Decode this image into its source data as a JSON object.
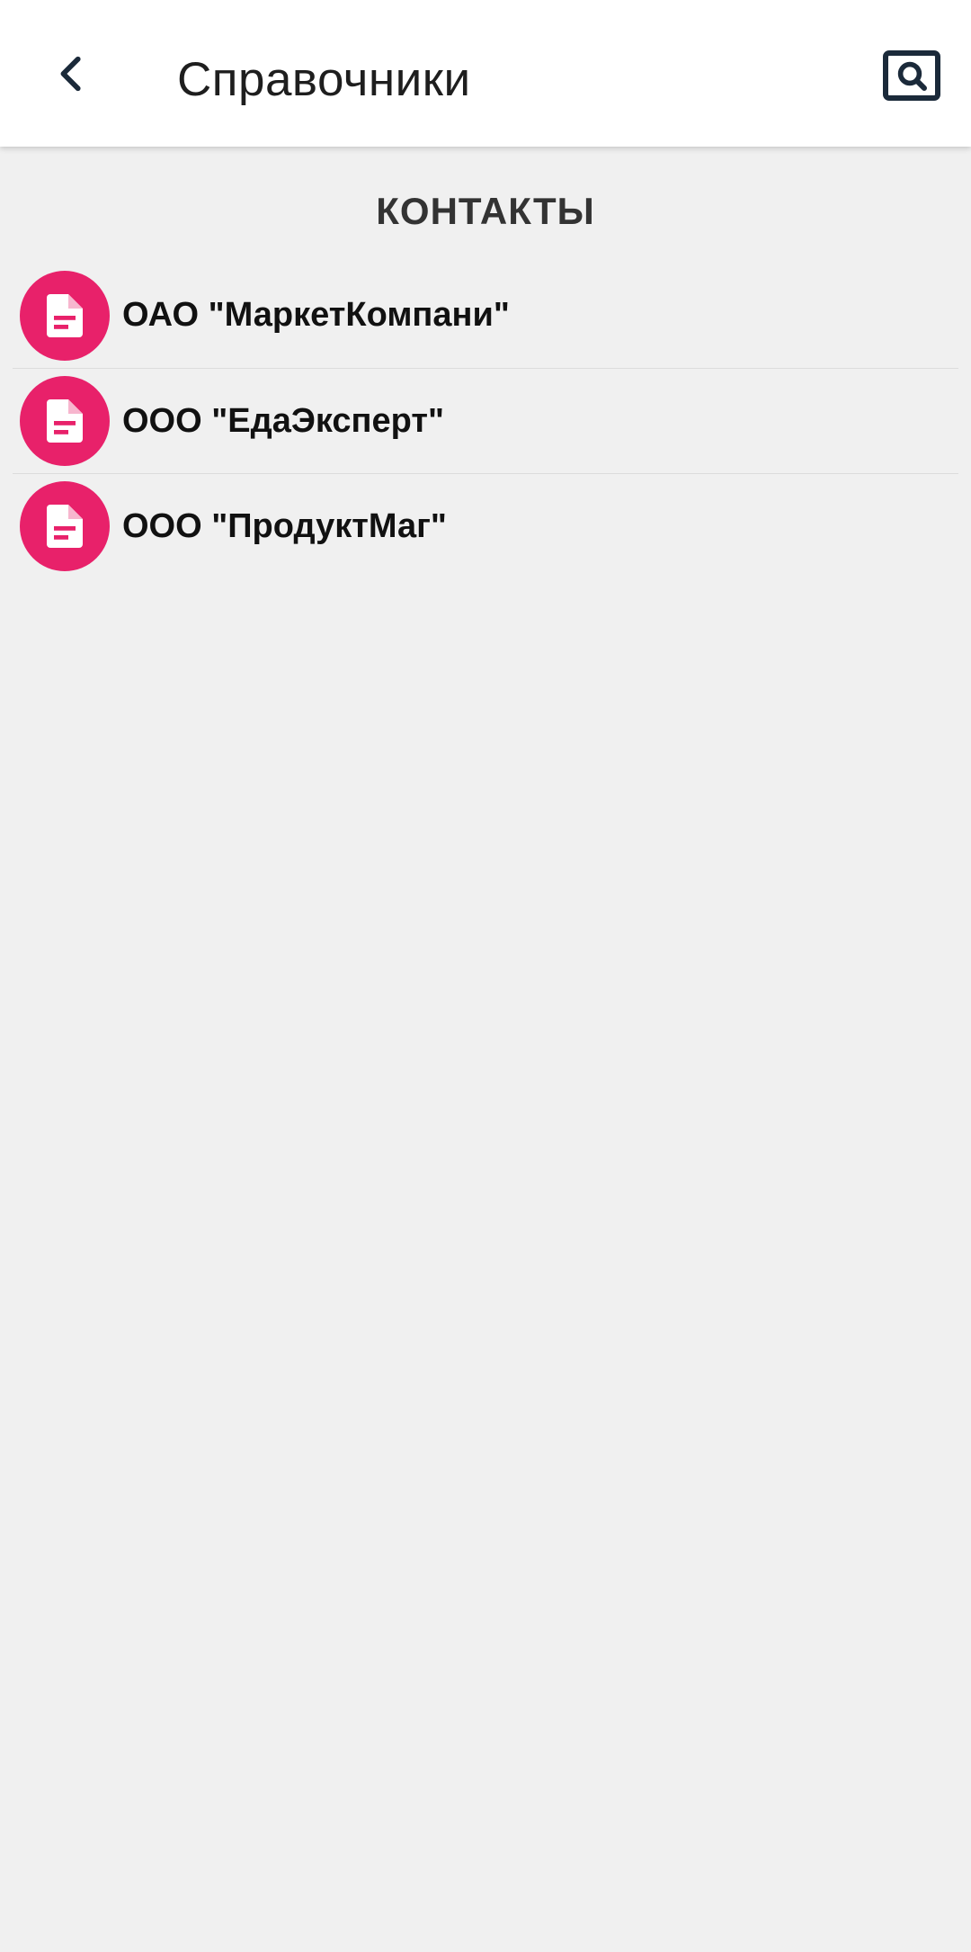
{
  "app_bar": {
    "title": "Справочники",
    "back_icon": "chevron-left-icon",
    "search_icon": "search-document-icon"
  },
  "section": {
    "title": "КОНТАКТЫ"
  },
  "contacts": [
    {
      "name": "ОАО \"МаркетКомпани\"",
      "icon": "document-icon"
    },
    {
      "name": "ООО \"ЕдаЭксперт\"",
      "icon": "document-icon"
    },
    {
      "name": "ООО \"ПродуктМаг\"",
      "icon": "document-icon"
    }
  ],
  "colors": {
    "accent": "#e8216a",
    "icon_dark": "#1b2a3a",
    "background": "#f0f0f0",
    "app_bar": "#ffffff"
  }
}
